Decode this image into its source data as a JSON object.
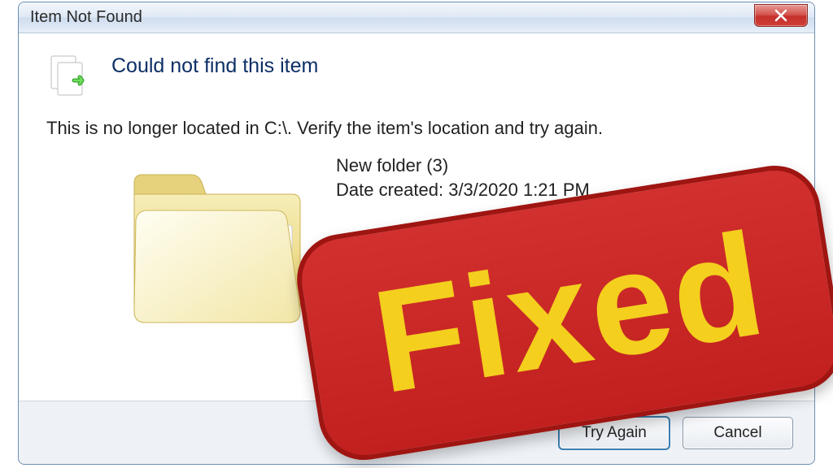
{
  "window": {
    "title": "Item Not Found"
  },
  "content": {
    "heading": "Could not find this item",
    "description": "This is no longer located in C:\\. Verify the item's location and try again.",
    "item_name": "New folder (3)",
    "item_date_label": "Date created:",
    "item_date": "3/3/2020 1:21 PM"
  },
  "buttons": {
    "try": "Try Again",
    "cancel": "Cancel"
  },
  "overlay": {
    "label": "Fixed"
  }
}
